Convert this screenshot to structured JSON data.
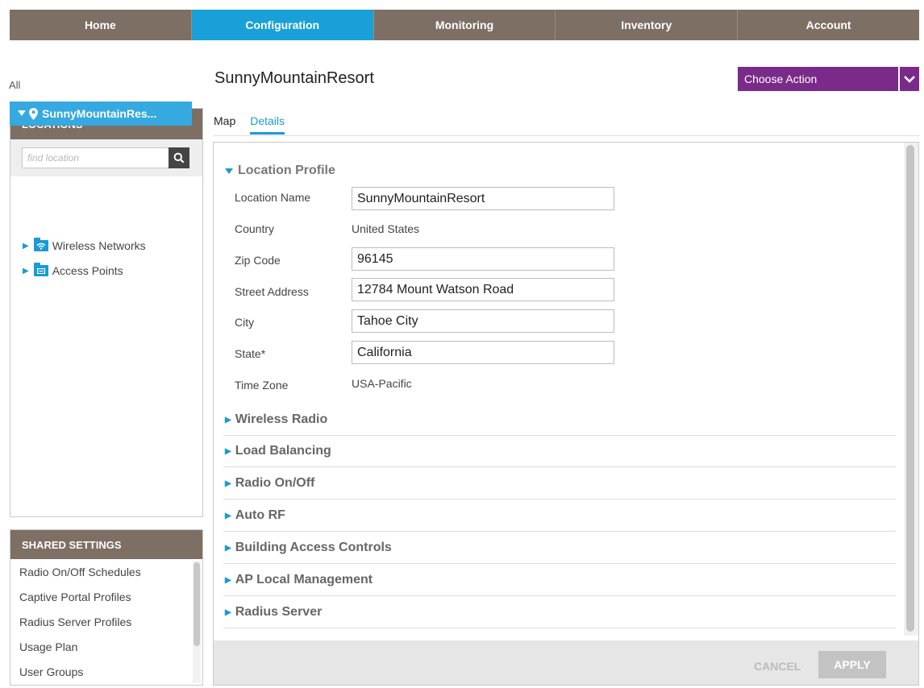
{
  "nav": {
    "tabs": [
      {
        "label": "Home",
        "active": false
      },
      {
        "label": "Configuration",
        "active": true
      },
      {
        "label": "Monitoring",
        "active": false
      },
      {
        "label": "Inventory",
        "active": false
      },
      {
        "label": "Account",
        "active": false
      }
    ]
  },
  "header": {
    "title": "SunnyMountainResort",
    "choose_action": "Choose Action"
  },
  "locations": {
    "heading": "LOCATIONS",
    "search_placeholder": "find location",
    "all_label": "All",
    "selected": "SunnyMountainRes...",
    "children": [
      "Wireless Networks",
      "Access Points"
    ]
  },
  "shared_settings": {
    "heading": "SHARED SETTINGS",
    "items": [
      "Radio On/Off Schedules",
      "Captive Portal Profiles",
      "Radius Server Profiles",
      "Usage Plan",
      "User Groups"
    ]
  },
  "subtabs": {
    "map": "Map",
    "details": "Details"
  },
  "location_profile": {
    "heading": "Location Profile",
    "fields": {
      "location_name": {
        "label": "Location Name",
        "value": "SunnyMountainResort"
      },
      "country": {
        "label": "Country",
        "value": "United States"
      },
      "zip": {
        "label": "Zip Code",
        "value": "96145"
      },
      "street": {
        "label": "Street Address",
        "value": "12784 Mount Watson Road"
      },
      "city": {
        "label": "City",
        "value": "Tahoe City"
      },
      "state": {
        "label": "State*",
        "value": "California"
      },
      "timezone": {
        "label": "Time Zone",
        "value": "USA-Pacific"
      }
    }
  },
  "sections": [
    "Wireless Radio",
    "Load Balancing",
    "Radio On/Off",
    "Auto RF",
    "Building Access Controls",
    "AP Local Management",
    "Radius Server"
  ],
  "footer": {
    "cancel": "CANCEL",
    "apply": "APPLY"
  },
  "colors": {
    "nav_bg": "#7d6f64",
    "nav_active": "#1aa0d8",
    "action_purple": "#7a2b8a",
    "accent_blue": "#1a9ad6"
  }
}
